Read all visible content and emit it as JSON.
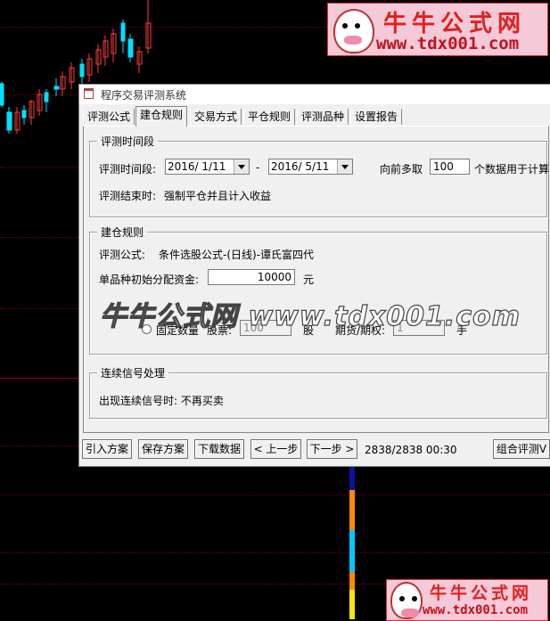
{
  "logos": {
    "top": {
      "cn": "牛牛公式网",
      "url": "www.tdx001.com"
    },
    "bottom": {
      "cn": "牛牛公式网",
      "url": "www.tdx001.com"
    }
  },
  "dialog": {
    "title": "程序交易评测系统",
    "tabs": [
      "评测公式",
      "建仓规则",
      "交易方式",
      "平仓规则",
      "评测品种",
      "设置报告"
    ],
    "active_tab": "建仓规则",
    "period_group": {
      "title": "评测时间段",
      "label": "评测时间段:",
      "start_date": "2016/ 1/11",
      "dash": "-",
      "end_date": "2016/ 5/11",
      "lookback_label": "向前多取",
      "lookback_value": "100",
      "lookback_suffix": "个数据用于计算",
      "end_label": "评测结束时:",
      "end_value": "强制平仓并且计入收益"
    },
    "build_group": {
      "title": "建仓规则",
      "formula_label": "评测公式:",
      "formula_value": "条件选股公式-(日线)-谭氏富四代",
      "capital_label": "单品种初始分配资金:",
      "capital_value": "10000",
      "capital_unit": "元",
      "fixed_amount_label": "固定数量",
      "stock_label": "股票:",
      "stock_value": "100",
      "stock_unit": "股",
      "futures_label": "期货/期权:",
      "futures_value": "1",
      "futures_unit": "手"
    },
    "signal_group": {
      "title": "连续信号处理",
      "text": "出现连续信号时: 不再买卖"
    },
    "buttons": {
      "import": "引入方案",
      "save": "保存方案",
      "download": "下载数据",
      "prev": "< 上一步",
      "next": "下一步 >",
      "status": "2838/2838  00:30",
      "combo": "组合评测V"
    }
  },
  "watermark": "牛牛公式网 www.tdx001.com"
}
